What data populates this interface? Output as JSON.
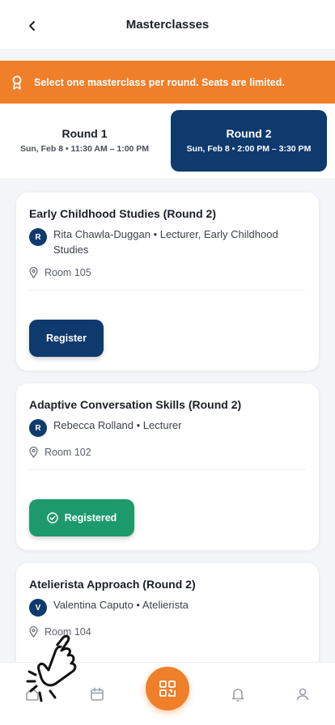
{
  "header": {
    "title": "Masterclasses",
    "back_icon": "chevron-left-icon"
  },
  "banner": {
    "icon": "award-icon",
    "text": "Select one masterclass per round. Seats are limited.",
    "color": "#f07f2a"
  },
  "rounds": [
    {
      "name": "Round 1",
      "time": "Sun, Feb 8 • 11:30 AM – 1:00 PM",
      "active": false
    },
    {
      "name": "Round 2",
      "time": "Sun, Feb 8 • 2:00 PM – 3:30 PM",
      "active": true
    }
  ],
  "classes": [
    {
      "title": "Early Childhood Studies (Round 2)",
      "avatar": "R",
      "speaker": "Rita Chawla-Duggan • Lecturer, Early Childhood Studies",
      "room": "Room 105",
      "button": "Register",
      "status": "register"
    },
    {
      "title": "Adaptive Conversation Skills (Round 2)",
      "avatar": "R",
      "speaker": "Rebecca Rolland • Lecturer",
      "room": "Room 102",
      "button": "Registered",
      "status": "registered"
    },
    {
      "title": "Atelierista Approach (Round 2)",
      "avatar": "V",
      "speaker": "Valentina Caputo • Atelierista",
      "room": "Room 104"
    }
  ],
  "tabbar": {
    "items": [
      "home-icon",
      "calendar-icon",
      "qr-code-icon",
      "bell-icon",
      "user-icon"
    ]
  },
  "colors": {
    "primary": "#0e3a6e",
    "accent": "#f07f2a",
    "success": "#1d9a6c"
  }
}
